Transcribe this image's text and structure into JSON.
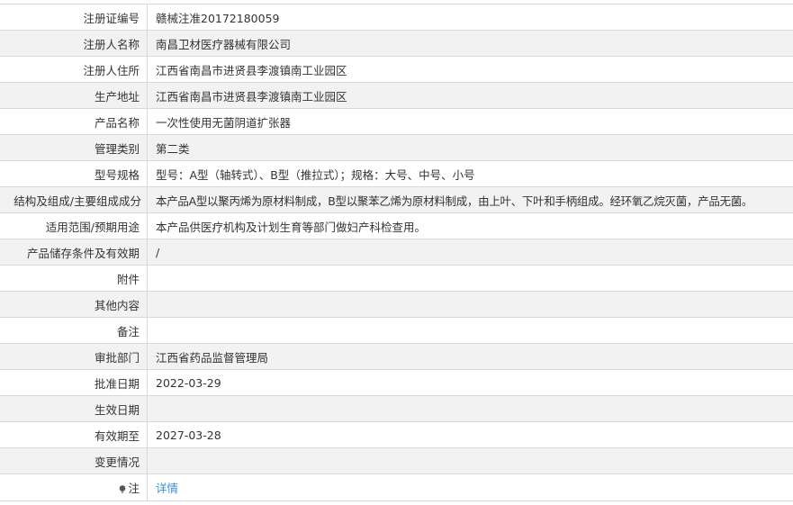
{
  "rows": [
    {
      "label": "注册证编号",
      "value": "赣械注准20172180059"
    },
    {
      "label": "注册人名称",
      "value": "南昌卫材医疗器械有限公司"
    },
    {
      "label": "注册人住所",
      "value": "江西省南昌市进贤县李渡镇南工业园区"
    },
    {
      "label": "生产地址",
      "value": "江西省南昌市进贤县李渡镇南工业园区"
    },
    {
      "label": "产品名称",
      "value": "一次性使用无菌阴道扩张器"
    },
    {
      "label": "管理类别",
      "value": "第二类"
    },
    {
      "label": "型号规格",
      "value": "型号：A型（轴转式）、B型（推拉式）；规格：大号、中号、小号"
    },
    {
      "label": "结构及组成/主要组成成分",
      "value": "本产品A型以聚丙烯为原材料制成，B型以聚苯乙烯为原材料制成，由上叶、下叶和手柄组成。经环氧乙烷灭菌，产品无菌。"
    },
    {
      "label": "适用范围/预期用途",
      "value": "本产品供医疗机构及计划生育等部门做妇产科检查用。"
    },
    {
      "label": "产品储存条件及有效期",
      "value": "/"
    },
    {
      "label": "附件",
      "value": ""
    },
    {
      "label": "其他内容",
      "value": ""
    },
    {
      "label": "备注",
      "value": ""
    },
    {
      "label": "审批部门",
      "value": "江西省药品监督管理局"
    },
    {
      "label": "批准日期",
      "value": "2022-03-29"
    },
    {
      "label": "生效日期",
      "value": ""
    },
    {
      "label": "有效期至",
      "value": "2027-03-28"
    },
    {
      "label": "变更情况",
      "value": ""
    }
  ],
  "note_row": {
    "label": "注",
    "icon": "pin-icon",
    "link_text": "详情",
    "link_color": "#3a8fd6"
  }
}
